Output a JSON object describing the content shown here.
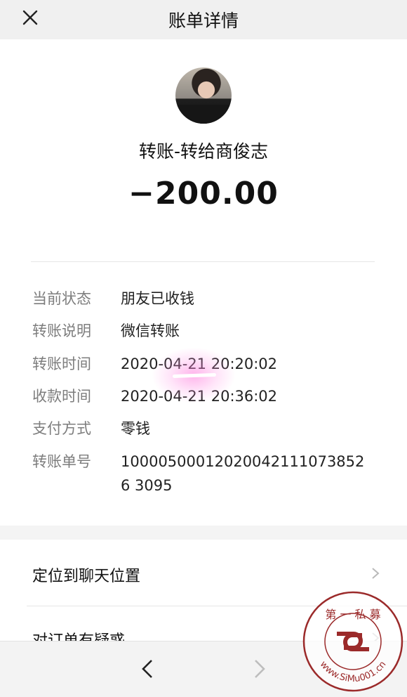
{
  "header": {
    "title": "账单详情",
    "close_icon": "close-icon"
  },
  "transaction": {
    "title": "转账-转给商俊志",
    "amount": "−200.00"
  },
  "details": [
    {
      "label": "当前状态",
      "value": "朋友已收钱"
    },
    {
      "label": "转账说明",
      "value": "微信转账"
    },
    {
      "label": "转账时间",
      "value": "2020-04-21 20:20:02"
    },
    {
      "label": "收款时间",
      "value": "2020-04-21 20:36:02"
    },
    {
      "label": "支付方式",
      "value": "零钱"
    },
    {
      "label": "转账单号",
      "value": "100005000120200421110738526 3095"
    }
  ],
  "menu": [
    {
      "label": "定位到聊天位置",
      "icon": "chevron-right-icon"
    },
    {
      "label": "对订单有疑惑",
      "icon": "chevron-right-icon"
    }
  ],
  "bottom_nav": {
    "back_icon": "chevron-left-icon",
    "forward_icon": "chevron-right-icon"
  },
  "watermark": {
    "top_text": "第 一 私 募",
    "bottom_text": "www.SiMu001.cn",
    "color": "#9b2a2a"
  }
}
